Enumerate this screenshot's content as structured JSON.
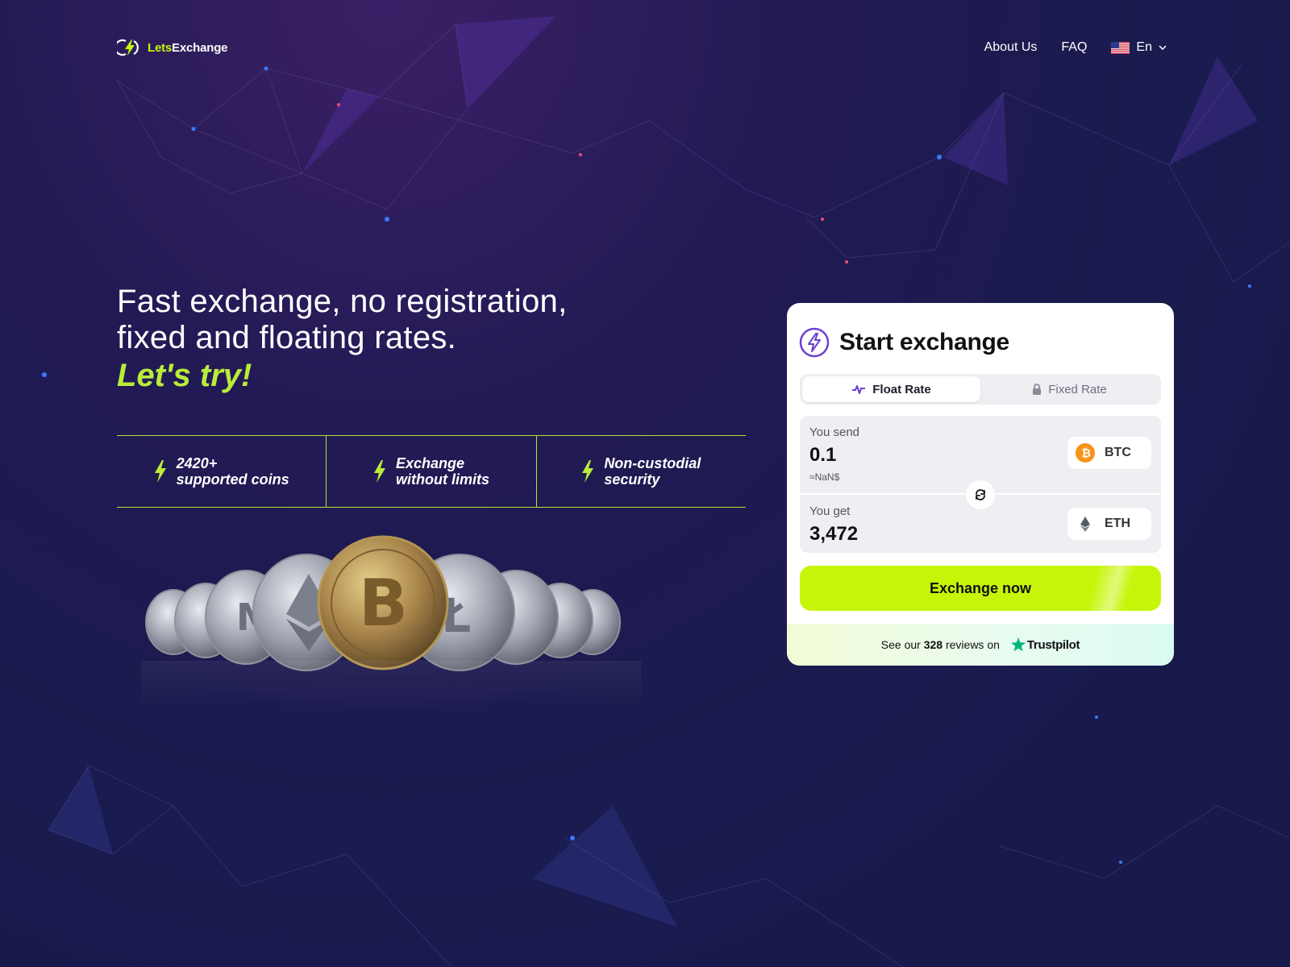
{
  "header": {
    "logo_lets": "Lets",
    "logo_exchange": "Exchange",
    "nav": [
      {
        "label": "About Us"
      },
      {
        "label": "FAQ"
      }
    ],
    "language": "En",
    "language_icon": "us-flag-icon"
  },
  "hero": {
    "title_line1": "Fast exchange, no registration,",
    "title_line2": "fixed and floating rates.",
    "cta": "Let's try!"
  },
  "features": [
    {
      "line1": "2420+",
      "line2": "supported coins",
      "icon": "lightning-icon"
    },
    {
      "line1": "Exchange",
      "line2": "without limits",
      "icon": "lightning-icon"
    },
    {
      "line1": "Non-custodial",
      "line2": "security",
      "icon": "lightning-icon"
    }
  ],
  "exchange": {
    "title": "Start exchange",
    "tabs": [
      {
        "label": "Float Rate",
        "icon": "pulse-icon",
        "active": true
      },
      {
        "label": "Fixed Rate",
        "icon": "lock-icon",
        "active": false
      }
    ],
    "send": {
      "label": "You send",
      "value": "0.1",
      "fiat": "≈NaN$",
      "coin": "BTC"
    },
    "get": {
      "label": "You get",
      "value": "3,472",
      "coin": "ETH"
    },
    "button": "Exchange now",
    "trust_pre": "See our",
    "trust_count": "328",
    "trust_post": "reviews on",
    "trust_brand": "Trustpilot"
  },
  "colors": {
    "accent": "#c7f50a",
    "accent_text": "#b9ec3a",
    "brand_purple": "#6b3fd4",
    "btc_orange": "#f7931a",
    "trustpilot_green": "#00b67a"
  }
}
